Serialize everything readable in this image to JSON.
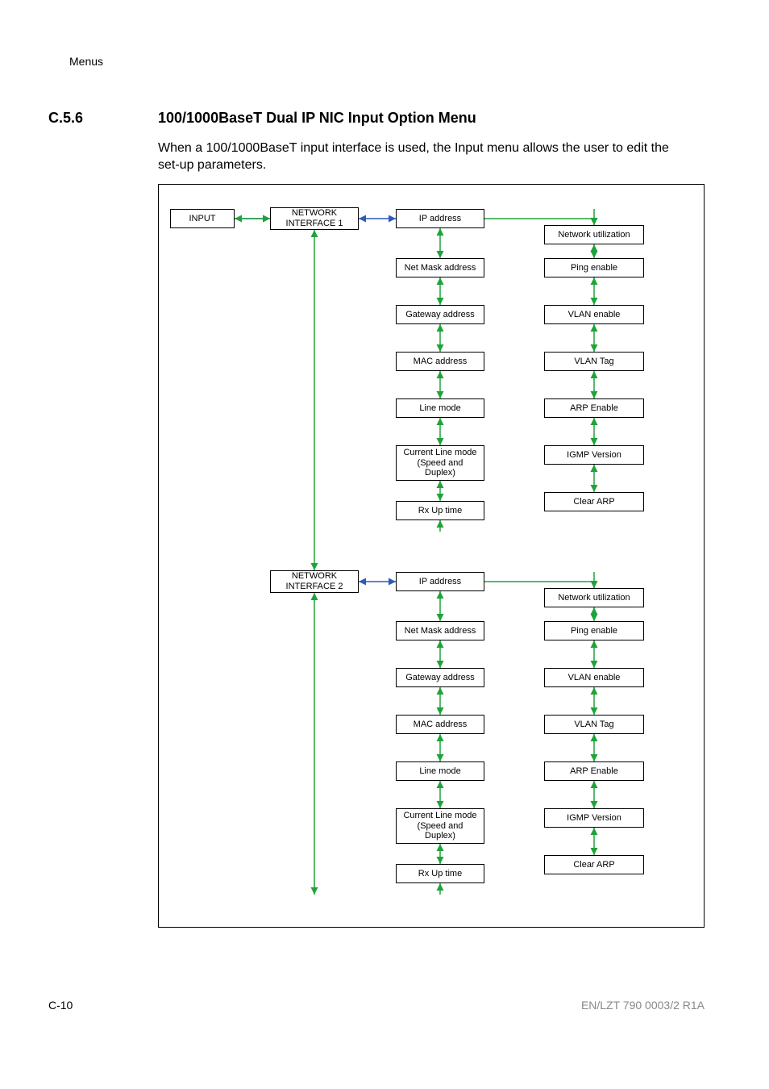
{
  "header": {
    "label": "Menus"
  },
  "section": {
    "number": "C.5.6",
    "title": "100/1000BaseT Dual IP NIC Input Option Menu",
    "paragraph": "When a 100/1000BaseT input interface is used, the Input menu allows the user to edit the set-up parameters."
  },
  "footer": {
    "page": "C-10",
    "docid": "EN/LZT 790 0003/2 R1A"
  },
  "diagram": {
    "input": "INPUT",
    "ni1": "NETWORK\nINTERFACE 1",
    "ni2": "NETWORK\nINTERFACE 2",
    "colA": {
      "1": "IP address",
      "2": "Net Mask address",
      "3": "Gateway address",
      "4": "MAC address",
      "5": "Line mode",
      "6": "Current Line mode\n(Speed and\nDuplex)",
      "7": "Rx Up time"
    },
    "colB": {
      "1": "Network utilization",
      "2": "Ping enable",
      "3": "VLAN enable",
      "4": "VLAN Tag",
      "5": "ARP Enable",
      "6": "IGMP Version",
      "7": "Clear ARP"
    }
  }
}
